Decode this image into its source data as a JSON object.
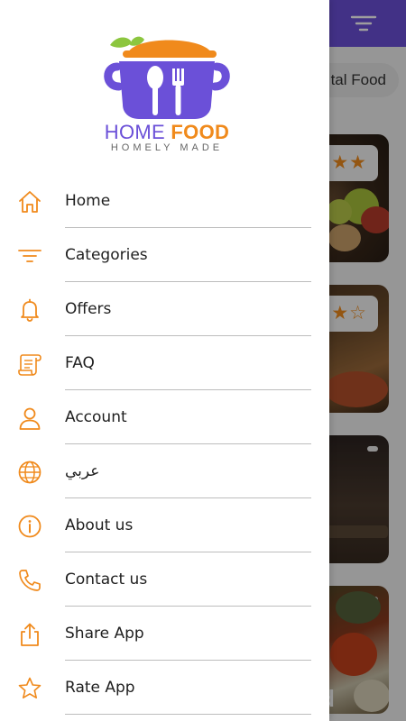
{
  "background": {
    "header_color": "#6b50d8",
    "chip_label": "tal Food",
    "cards": [
      {
        "rating": "★★★"
      },
      {
        "rating": "★★☆"
      },
      {
        "rating": ""
      },
      {
        "rating": ""
      }
    ],
    "partial_text": "d"
  },
  "drawer": {
    "logo": {
      "brand_home": "HOME ",
      "brand_food": "FOOD",
      "tagline": "HOMELY MADE",
      "primary_color": "#6b50d8",
      "accent_color": "#f08a1c"
    },
    "items": [
      {
        "label": "Home",
        "icon": "home-icon"
      },
      {
        "label": "Categories",
        "icon": "filter-lines-icon"
      },
      {
        "label": "Offers",
        "icon": "bell-icon"
      },
      {
        "label": "FAQ",
        "icon": "scroll-icon"
      },
      {
        "label": "Account",
        "icon": "user-icon"
      },
      {
        "label": "عربي",
        "icon": "globe-icon"
      },
      {
        "label": "About us",
        "icon": "info-icon"
      },
      {
        "label": "Contact us",
        "icon": "phone-icon"
      },
      {
        "label": "Share App",
        "icon": "share-icon"
      },
      {
        "label": "Rate App",
        "icon": "star-icon"
      }
    ],
    "icon_color": "#f08a1c"
  }
}
